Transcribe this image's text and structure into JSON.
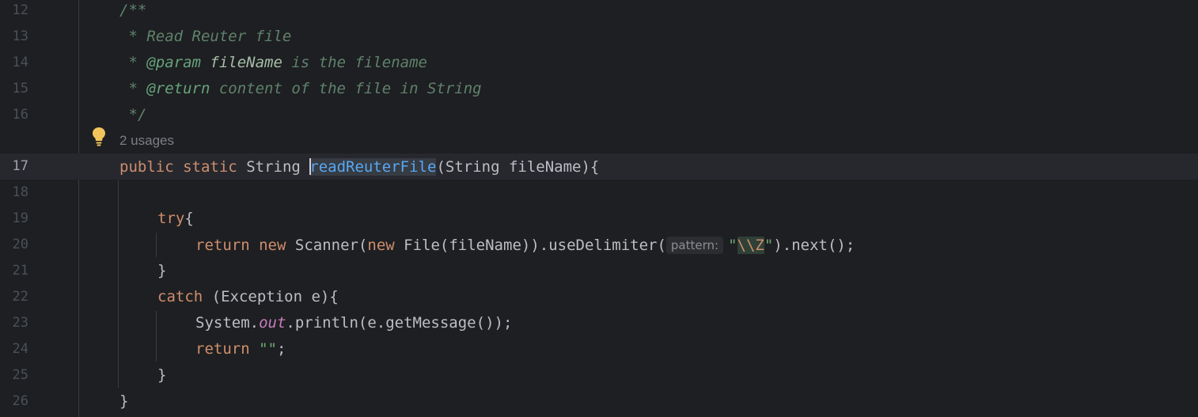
{
  "editor": {
    "language": "Java",
    "current_line": "17",
    "codelens": {
      "usages": "2 usages"
    },
    "lines": [
      {
        "n": "12",
        "text": "/**"
      },
      {
        "n": "13",
        "text": " * Read Reuter file"
      },
      {
        "n": "14",
        "text": " * @param fileName is the filename"
      },
      {
        "n": "15",
        "text": " * @return content of the file in String"
      },
      {
        "n": "16",
        "text": " */"
      },
      {
        "n": "17",
        "text": "public static String readReuterFile(String fileName){"
      },
      {
        "n": "18",
        "text": ""
      },
      {
        "n": "19",
        "text": "try{"
      },
      {
        "n": "20",
        "text": "return new Scanner(new File(fileName)).useDelimiter(pattern: \"\\\\Z\").next();"
      },
      {
        "n": "21",
        "text": "}"
      },
      {
        "n": "22",
        "text": "catch (Exception e){"
      },
      {
        "n": "23",
        "text": "System.out.println(e.getMessage());"
      },
      {
        "n": "24",
        "text": "return \"\";"
      },
      {
        "n": "25",
        "text": "}"
      },
      {
        "n": "26",
        "text": "}"
      }
    ],
    "tokens": {
      "l12": "/**",
      "l13": " * Read Reuter file",
      "l14_star": " * ",
      "l14_tag": "@param",
      "l14_sp": " ",
      "l14_name": "fileName",
      "l14_rest": " is the filename",
      "l15_star": " * ",
      "l15_tag": "@return",
      "l15_rest": " content of the file in String",
      "l16": " */",
      "l17_public": "public",
      "l17_static": "static",
      "l17_type": "String",
      "l17_name": "readReuterFile",
      "l17_params": "(String fileName){",
      "l19_try": "try",
      "l19_brace": "{",
      "l20_return": "return",
      "l20_new1": "new",
      "l20_scanner": "Scanner(",
      "l20_new2": "new",
      "l20_file": "File(fileName)).useDelimiter(",
      "l20_hint": "pattern:",
      "l20_quote_open": "\"",
      "l20_esc": "\\\\Z",
      "l20_quote_close": "\"",
      "l20_tail": ").next();",
      "l21": "}",
      "l22_catch": "catch",
      "l22_rest": " (Exception e){",
      "l23_sys": "System.",
      "l23_out": "out",
      "l23_rest": ".println(e.getMessage());",
      "l24_return": "return",
      "l24_str": "\"\"",
      "l24_semi": ";",
      "l25": "}",
      "l26": "}"
    },
    "icons": {
      "intention": "lightbulb-icon"
    },
    "colors": {
      "background": "#1e1f22",
      "keyword": "#cf8e6d",
      "comment": "#5f826b",
      "function": "#56a8f5",
      "string": "#6aab73",
      "static_field": "#c77dbb"
    }
  }
}
